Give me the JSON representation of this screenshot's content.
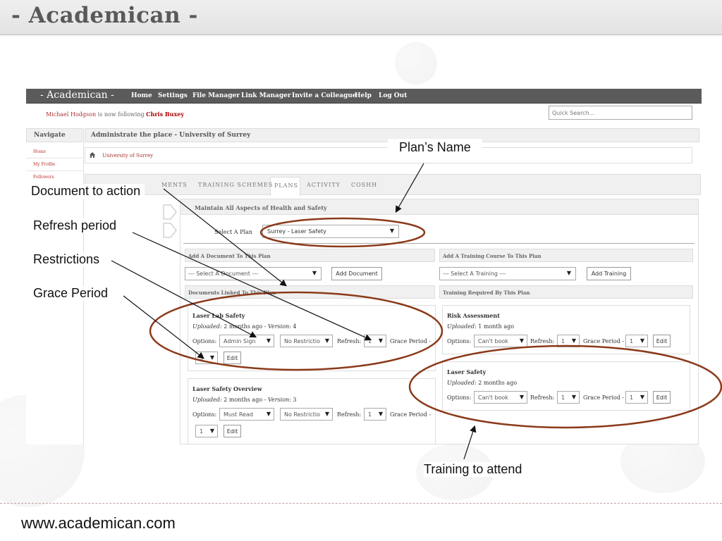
{
  "slide": {
    "title": "- Academican -",
    "footer_url": "www.academican.com"
  },
  "app": {
    "logo": "- Academican -",
    "nav": [
      "Home",
      "Settings",
      "File Manager",
      "Link Manager",
      "Invite a Colleague",
      "Help",
      "Log Out"
    ],
    "follow": {
      "user": "Michael Hodgson",
      "middle": " is now following ",
      "target": "Chris Buxey"
    },
    "quick_search_placeholder": "Quick Search...",
    "sidebar": {
      "title": "Navigate",
      "items": [
        "Home",
        "My Profile",
        "Followers"
      ]
    },
    "admin_title": "Administrate the place - University of Surrey",
    "breadcrumb": "University of Surrey",
    "tabs": [
      "MENTS",
      "TRAINING SCHEMES",
      "PLANS",
      "ACTIVITY",
      "COSHH"
    ],
    "panel_title": "Maintain All Aspects of Health and Safety",
    "select_plan_label": "Select A Plan",
    "plan_value": "Surrey - Laser Safety",
    "add_document": {
      "heading": "Add A Document To This Plan",
      "select": "--- Select A Document ---",
      "button": "Add Document"
    },
    "add_training": {
      "heading": "Add A Training Course To This Plan",
      "select": "--- Select A Training ---",
      "button": "Add Training"
    },
    "docs_heading": "Documents Linked To This Plan",
    "training_heading": "Training Required By This Plan",
    "labels": {
      "uploaded": "Uploaded:",
      "version": "Version:",
      "options": "Options:",
      "refresh": "Refresh:",
      "grace": "Grace Period -",
      "edit": "Edit"
    },
    "documents": [
      {
        "title": "Laser Lab Safety",
        "uploaded": " 2 months ago - ",
        "version": " 4",
        "option": "Admin Sign",
        "restriction": "No Restrictio",
        "refresh": "1",
        "grace": "3"
      },
      {
        "title": "Laser Safety Overview",
        "uploaded": " 2 months ago - ",
        "version": " 3",
        "option": "Must Read",
        "restriction": "No Restrictio",
        "refresh": "1",
        "grace": "1"
      }
    ],
    "trainings": [
      {
        "title": "Risk Assessment",
        "uploaded": " 1 month ago",
        "option": "Can't book",
        "refresh": "1",
        "grace": "1"
      },
      {
        "title": "Laser Safety",
        "uploaded": " 2 months ago",
        "option": "Can't book",
        "refresh": "1",
        "grace": "1"
      }
    ]
  },
  "annotations": {
    "plan_name": "Plan’s Name",
    "document_to_action": "Document to action",
    "refresh_period": "Refresh period",
    "restrictions": "Restrictions",
    "grace_period": "Grace Period",
    "training_to_attend": "Training to attend"
  },
  "colors": {
    "accent_red": "#a33333",
    "ellipse": "#8b3a1a",
    "nav_bg": "#5b5b5b"
  }
}
